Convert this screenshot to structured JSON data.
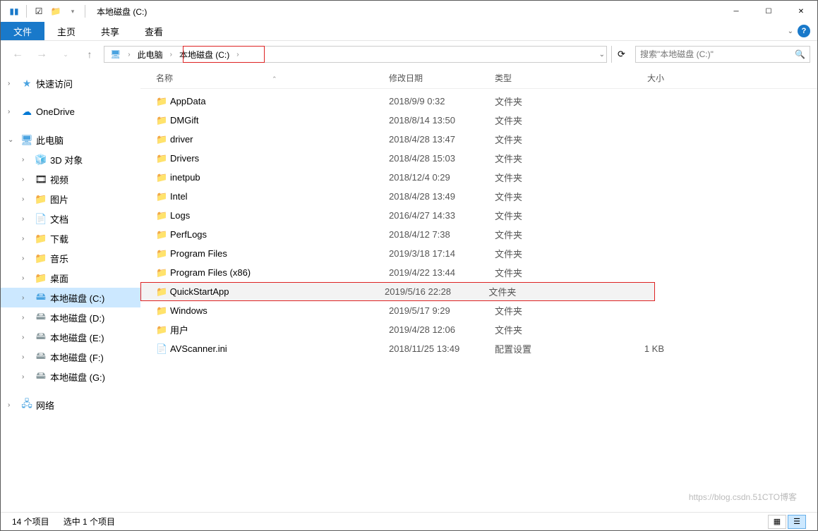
{
  "title": "本地磁盘 (C:)",
  "menu": {
    "file": "文件",
    "home": "主页",
    "share": "共享",
    "view": "查看"
  },
  "breadcrumb": {
    "pc": "此电脑",
    "drive": "本地磁盘 (C:)"
  },
  "search": {
    "placeholder": "搜索\"本地磁盘 (C:)\""
  },
  "nav": {
    "quick": "快速访问",
    "onedrive": "OneDrive",
    "thispc": "此电脑",
    "3d": "3D 对象",
    "video": "视频",
    "pics": "图片",
    "docs": "文档",
    "downloads": "下载",
    "music": "音乐",
    "desktop": "桌面",
    "driveC": "本地磁盘 (C:)",
    "driveD": "本地磁盘 (D:)",
    "driveE": "本地磁盘 (E:)",
    "driveF": "本地磁盘 (F:)",
    "driveG": "本地磁盘 (G:)",
    "network": "网络"
  },
  "cols": {
    "name": "名称",
    "date": "修改日期",
    "type": "类型",
    "size": "大小"
  },
  "files": [
    {
      "name": "AppData",
      "date": "2018/9/9 0:32",
      "type": "文件夹",
      "size": "",
      "icon": "📁"
    },
    {
      "name": "DMGift",
      "date": "2018/8/14 13:50",
      "type": "文件夹",
      "size": "",
      "icon": "📁"
    },
    {
      "name": "driver",
      "date": "2018/4/28 13:47",
      "type": "文件夹",
      "size": "",
      "icon": "📁"
    },
    {
      "name": "Drivers",
      "date": "2018/4/28 15:03",
      "type": "文件夹",
      "size": "",
      "icon": "📁"
    },
    {
      "name": "inetpub",
      "date": "2018/12/4 0:29",
      "type": "文件夹",
      "size": "",
      "icon": "📁"
    },
    {
      "name": "Intel",
      "date": "2018/4/28 13:49",
      "type": "文件夹",
      "size": "",
      "icon": "📁"
    },
    {
      "name": "Logs",
      "date": "2016/4/27 14:33",
      "type": "文件夹",
      "size": "",
      "icon": "📁"
    },
    {
      "name": "PerfLogs",
      "date": "2018/4/12 7:38",
      "type": "文件夹",
      "size": "",
      "icon": "📁"
    },
    {
      "name": "Program Files",
      "date": "2019/3/18 17:14",
      "type": "文件夹",
      "size": "",
      "icon": "📁"
    },
    {
      "name": "Program Files (x86)",
      "date": "2019/4/22 13:44",
      "type": "文件夹",
      "size": "",
      "icon": "📁"
    },
    {
      "name": "QuickStartApp",
      "date": "2019/5/16 22:28",
      "type": "文件夹",
      "size": "",
      "icon": "📁",
      "hl": true
    },
    {
      "name": "Windows",
      "date": "2019/5/17 9:29",
      "type": "文件夹",
      "size": "",
      "icon": "📁"
    },
    {
      "name": "用户",
      "date": "2019/4/28 12:06",
      "type": "文件夹",
      "size": "",
      "icon": "📁"
    },
    {
      "name": "AVScanner.ini",
      "date": "2018/11/25 13:49",
      "type": "配置设置",
      "size": "1 KB",
      "icon": "📄"
    }
  ],
  "status": {
    "items": "14 个项目",
    "selected": "选中 1 个项目"
  },
  "watermark": "https://blog.csdn.51CTO博客"
}
